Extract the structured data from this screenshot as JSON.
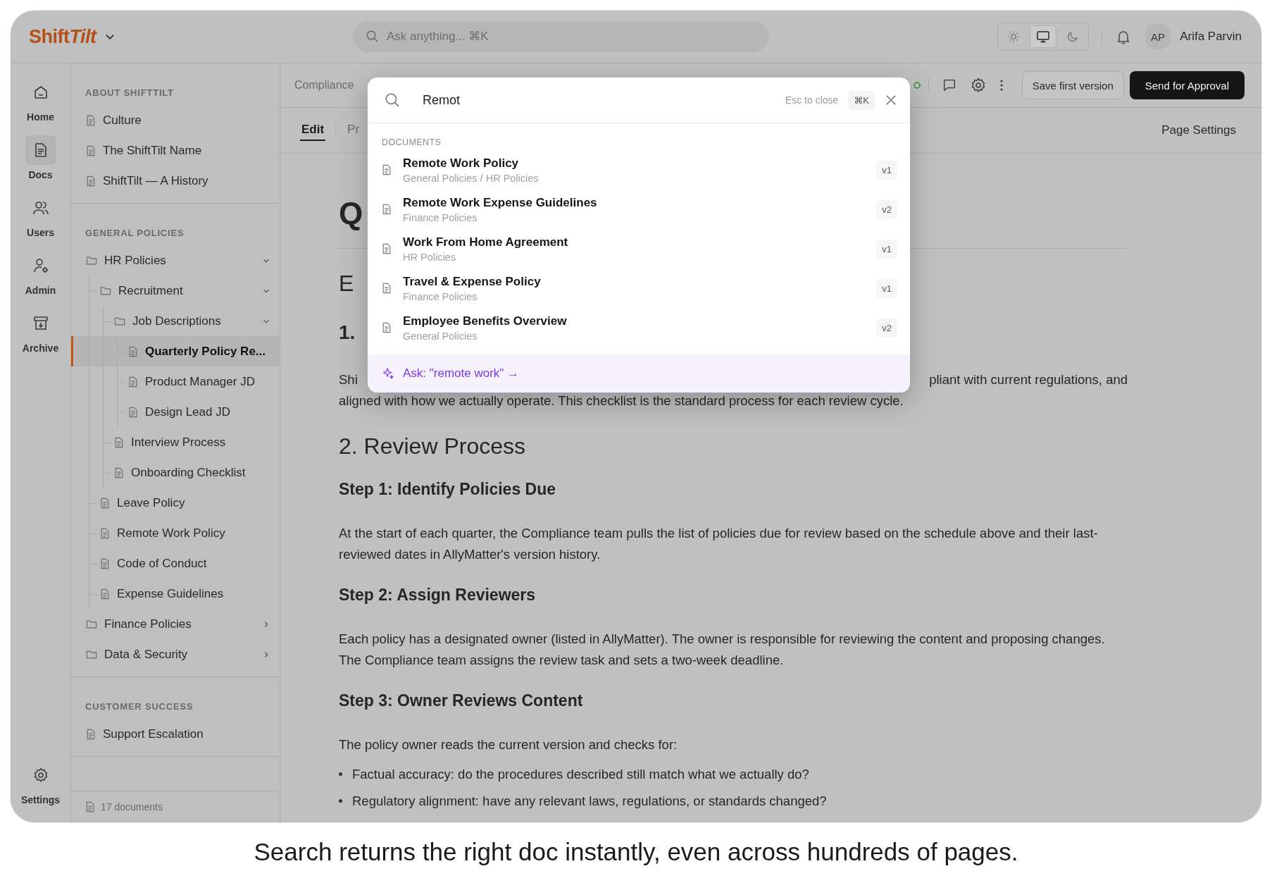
{
  "app": {
    "logo_main": "Shift",
    "logo_accent": "Tilt",
    "search_placeholder": "Ask anything... ⌘K"
  },
  "theme_toggle": [
    {
      "kind": "light",
      "selected": false
    },
    {
      "kind": "system",
      "selected": true
    },
    {
      "kind": "dark",
      "selected": false
    }
  ],
  "user": {
    "initials": "AP",
    "name": "Arifa Parvin"
  },
  "rail": [
    {
      "kind": "home",
      "label": "Home",
      "selected": false
    },
    {
      "kind": "docs",
      "label": "Docs",
      "selected": true
    },
    {
      "kind": "users",
      "label": "Users",
      "selected": false
    },
    {
      "kind": "admin",
      "label": "Admin",
      "selected": false
    },
    {
      "kind": "archive",
      "label": "Archive",
      "selected": false
    },
    {
      "kind": "settings",
      "label": "Settings",
      "selected": false
    }
  ],
  "sidebar": {
    "sections": [
      {
        "title": "ABOUT SHIFTTILT",
        "items": [
          {
            "kind": "doc",
            "label": "Culture",
            "selected": false
          },
          {
            "kind": "doc",
            "label": "The ShiftTilt Name",
            "selected": false
          },
          {
            "kind": "doc",
            "label": "ShiftTilt — A History",
            "selected": false
          }
        ]
      },
      {
        "title": "GENERAL POLICIES",
        "items": [
          {
            "kind": "folder",
            "label": "HR Policies",
            "expanded": true,
            "children": [
              {
                "kind": "folder",
                "label": "Recruitment",
                "expanded": true,
                "children": [
                  {
                    "kind": "folder",
                    "label": "Job Descriptions",
                    "expanded": true,
                    "children": [
                      {
                        "kind": "doc",
                        "label": "Quarterly Policy Re...",
                        "selected": true
                      },
                      {
                        "kind": "doc",
                        "label": "Product Manager JD",
                        "selected": false
                      },
                      {
                        "kind": "doc",
                        "label": "Design Lead JD",
                        "selected": false
                      }
                    ]
                  },
                  {
                    "kind": "doc",
                    "label": "Interview Process",
                    "selected": false
                  },
                  {
                    "kind": "doc",
                    "label": "Onboarding Checklist",
                    "selected": false
                  }
                ]
              },
              {
                "kind": "doc",
                "label": "Leave Policy",
                "selected": false
              },
              {
                "kind": "doc",
                "label": "Remote Work Policy",
                "selected": false
              },
              {
                "kind": "doc",
                "label": "Code of Conduct",
                "selected": false
              },
              {
                "kind": "doc",
                "label": "Expense Guidelines",
                "selected": false
              }
            ]
          },
          {
            "kind": "folder",
            "label": "Finance Policies",
            "expanded": false
          },
          {
            "kind": "folder",
            "label": "Data & Security",
            "expanded": false
          }
        ]
      },
      {
        "title": "CUSTOMER SUCCESS",
        "items": [
          {
            "kind": "doc",
            "label": "Support Escalation",
            "selected": false
          }
        ]
      }
    ],
    "footer": "17 documents"
  },
  "toolbar": {
    "breadcrumb": "Compliance",
    "save_button": "Save first version",
    "approve_button": "Send for Approval"
  },
  "tabs": [
    {
      "label": "Edit",
      "selected": true
    },
    {
      "label": "Pr",
      "selected": false
    }
  ],
  "page_settings": "Page Settings",
  "document": {
    "blocks": [
      {
        "kind": "h1",
        "text": "Q"
      },
      {
        "kind": "h2",
        "text": "E"
      },
      {
        "kind": "h3num",
        "text": "1."
      },
      {
        "kind": "split",
        "left": "Shi",
        "right": "pliant with current regulations, and"
      },
      {
        "kind": "p",
        "text": "aligned with how we actually operate. This checklist is the standard process for each review cycle."
      },
      {
        "kind": "h2",
        "text": "2. Review Process"
      },
      {
        "kind": "h3",
        "text": "Step 1: Identify Policies Due"
      },
      {
        "kind": "p",
        "text": "At the start of each quarter, the Compliance team pulls the list of policies due for review based on the schedule above and their last-reviewed dates in AllyMatter's version history."
      },
      {
        "kind": "h3",
        "text": "Step 2: Assign Reviewers"
      },
      {
        "kind": "p",
        "text": "Each policy has a designated owner (listed in AllyMatter). The owner is responsible for reviewing the content and proposing changes. The Compliance team assigns the review task and sets a two-week deadline."
      },
      {
        "kind": "h3",
        "text": "Step 3: Owner Reviews Content"
      },
      {
        "kind": "p",
        "text": "The policy owner reads the current version and checks for:"
      },
      {
        "kind": "bullet",
        "text": "Factual accuracy: do the procedures described still match what we actually do?"
      },
      {
        "kind": "bullet",
        "text": "Regulatory alignment: have any relevant laws, regulations, or standards changed?"
      }
    ]
  },
  "search_modal": {
    "query": "Remot",
    "hint": "Esc to close",
    "shortcut": "⌘K",
    "section": "DOCUMENTS",
    "results": [
      {
        "title": "Remote Work Policy",
        "path": "General Policies / HR Policies",
        "version": "v1"
      },
      {
        "title": "Remote Work Expense Guidelines",
        "path": "Finance Policies",
        "version": "v2"
      },
      {
        "title": "Work From Home Agreement",
        "path": "HR Policies",
        "version": "v1"
      },
      {
        "title": "Travel & Expense Policy",
        "path": "Finance Policies",
        "version": "v1"
      },
      {
        "title": "Employee Benefits Overview",
        "path": "General Policies",
        "version": "v2"
      }
    ],
    "ask": "Ask: \"remote work\" →"
  },
  "caption": "Search returns the right doc instantly, even across hundreds of pages."
}
